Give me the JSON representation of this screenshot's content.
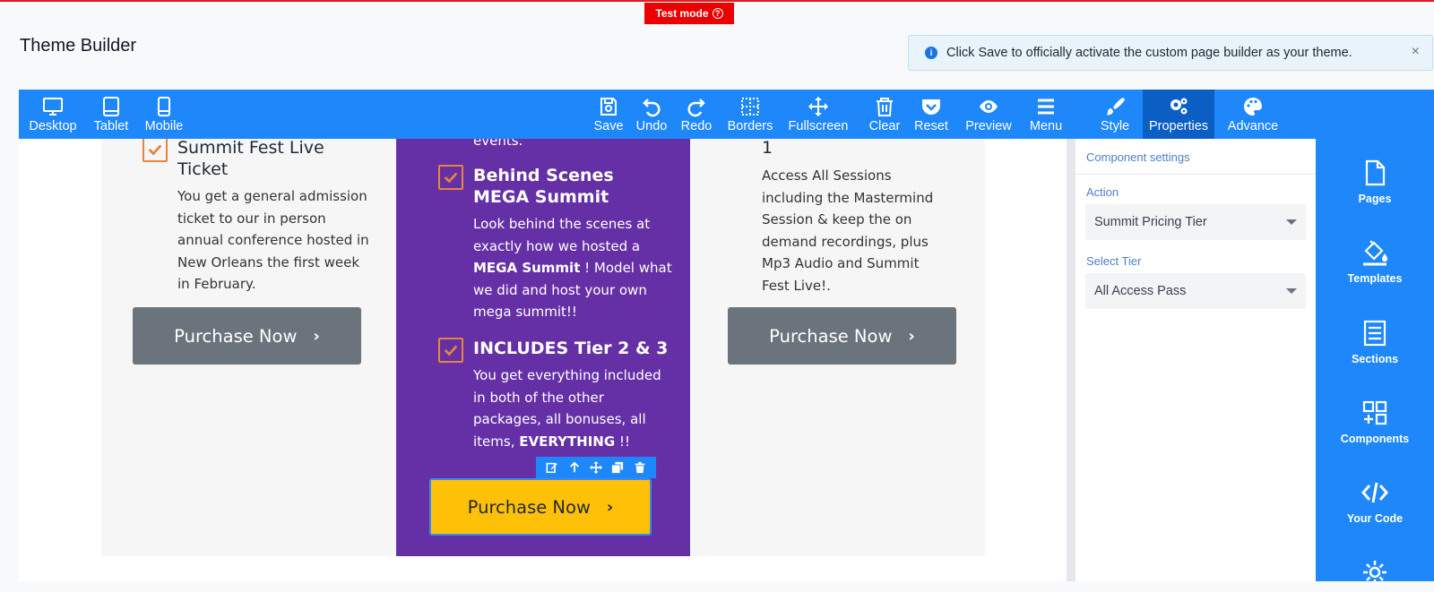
{
  "banner": {
    "test_mode": "Test mode"
  },
  "page": {
    "title": "Theme Builder"
  },
  "notice": {
    "text": "Click Save to officially activate the custom page builder as your theme."
  },
  "toolbar": {
    "desktop": "Desktop",
    "tablet": "Tablet",
    "mobile": "Mobile",
    "save": "Save",
    "undo": "Undo",
    "redo": "Redo",
    "borders": "Borders",
    "fullscreen": "Fullscreen",
    "clear": "Clear",
    "reset": "Reset",
    "preview": "Preview",
    "menu": "Menu",
    "style": "Style",
    "properties": "Properties",
    "advance": "Advance"
  },
  "pricing": {
    "left": {
      "feature_title": "Summit Fest Live Ticket",
      "feature_desc": "You get a general admission ticket to our in person annual conference hosted in New Orleans the first week in February.",
      "button": "Purchase Now"
    },
    "middle": {
      "top_text": "events.",
      "feature1_title": "Behind Scenes MEGA Summit",
      "feature1_desc_a": "Look behind the scenes at exactly how we hosted a ",
      "feature1_desc_bold": "MEGA Summit",
      "feature1_desc_b": " ! Model what we did and host your own mega summit!!",
      "feature2_title": "INCLUDES Tier 2 & 3",
      "feature2_desc_a": "You get everything included in both of the other packages, all bonuses, all items, ",
      "feature2_desc_bold": "EVERYTHING",
      "feature2_desc_b": " !!",
      "button": "Purchase Now"
    },
    "right": {
      "feature_title": "1",
      "feature_desc": "Access All Sessions including the Mastermind Session & keep the on demand recordings, plus Mp3 Audio and Summit Fest Live!.",
      "button": "Purchase Now"
    }
  },
  "properties_panel": {
    "header": "Component settings",
    "action_label": "Action",
    "action_value": "Summit Pricing Tier",
    "tier_label": "Select Tier",
    "tier_value": "All Access Pass"
  },
  "right_sidebar": {
    "pages": "Pages",
    "templates": "Templates",
    "sections": "Sections",
    "components": "Components",
    "your_code": "Your Code"
  },
  "colors": {
    "toolbar": "#1e88fb",
    "active_tab": "#0b5fc4",
    "featured_column": "#6530a6",
    "gold_button": "#ffc107",
    "grey_button": "#6b747d",
    "check_orange": "#e8843c"
  }
}
